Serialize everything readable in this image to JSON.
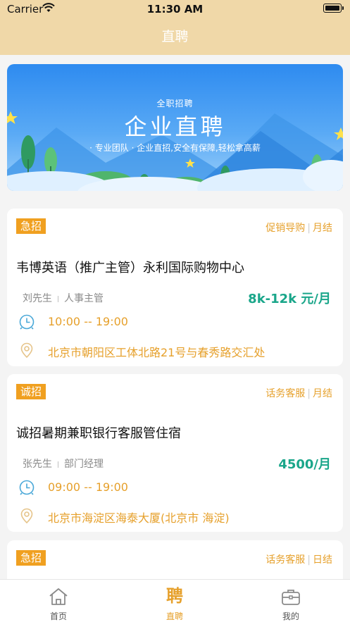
{
  "status_bar": {
    "carrier": "Carrier",
    "time": "11:30 AM"
  },
  "nav": {
    "title": "直聘"
  },
  "banner": {
    "subtitle": "全职招聘",
    "title": "企业直聘",
    "slogan": "· 专业团队 · 企业直招,安全有保障,轻松拿高薪"
  },
  "jobs": [
    {
      "tag": "急招",
      "category": "促销导购",
      "pay_cycle": "月结",
      "title": "韦博英语（推广主管）永利国际购物中心",
      "contact_name": "刘先生",
      "contact_role": "人事主管",
      "salary": "8k-12k 元/月",
      "hours": "10:00 -- 19:00",
      "address": "北京市朝阳区工体北路21号与春秀路交汇处"
    },
    {
      "tag": "诚招",
      "category": "话务客服",
      "pay_cycle": "月结",
      "title": "诚招暑期兼职银行客服管住宿",
      "contact_name": "张先生",
      "contact_role": "部门经理",
      "salary": "4500/月",
      "hours": "09:00 -- 19:00",
      "address": "北京市海淀区海泰大厦(北京市 海淀)"
    },
    {
      "tag": "急招",
      "category": "话务客服",
      "pay_cycle": "日结"
    }
  ],
  "tabbar": {
    "items": [
      {
        "label": "首页",
        "icon": "home-icon"
      },
      {
        "label": "直聘",
        "icon": "pin-glyph-icon",
        "glyph": "聘"
      },
      {
        "label": "我的",
        "icon": "briefcase-icon"
      }
    ]
  },
  "colors": {
    "header": "#f0d8a8",
    "accent": "#e6a02b",
    "tag": "#f0a020",
    "salary": "#1aa68a"
  }
}
